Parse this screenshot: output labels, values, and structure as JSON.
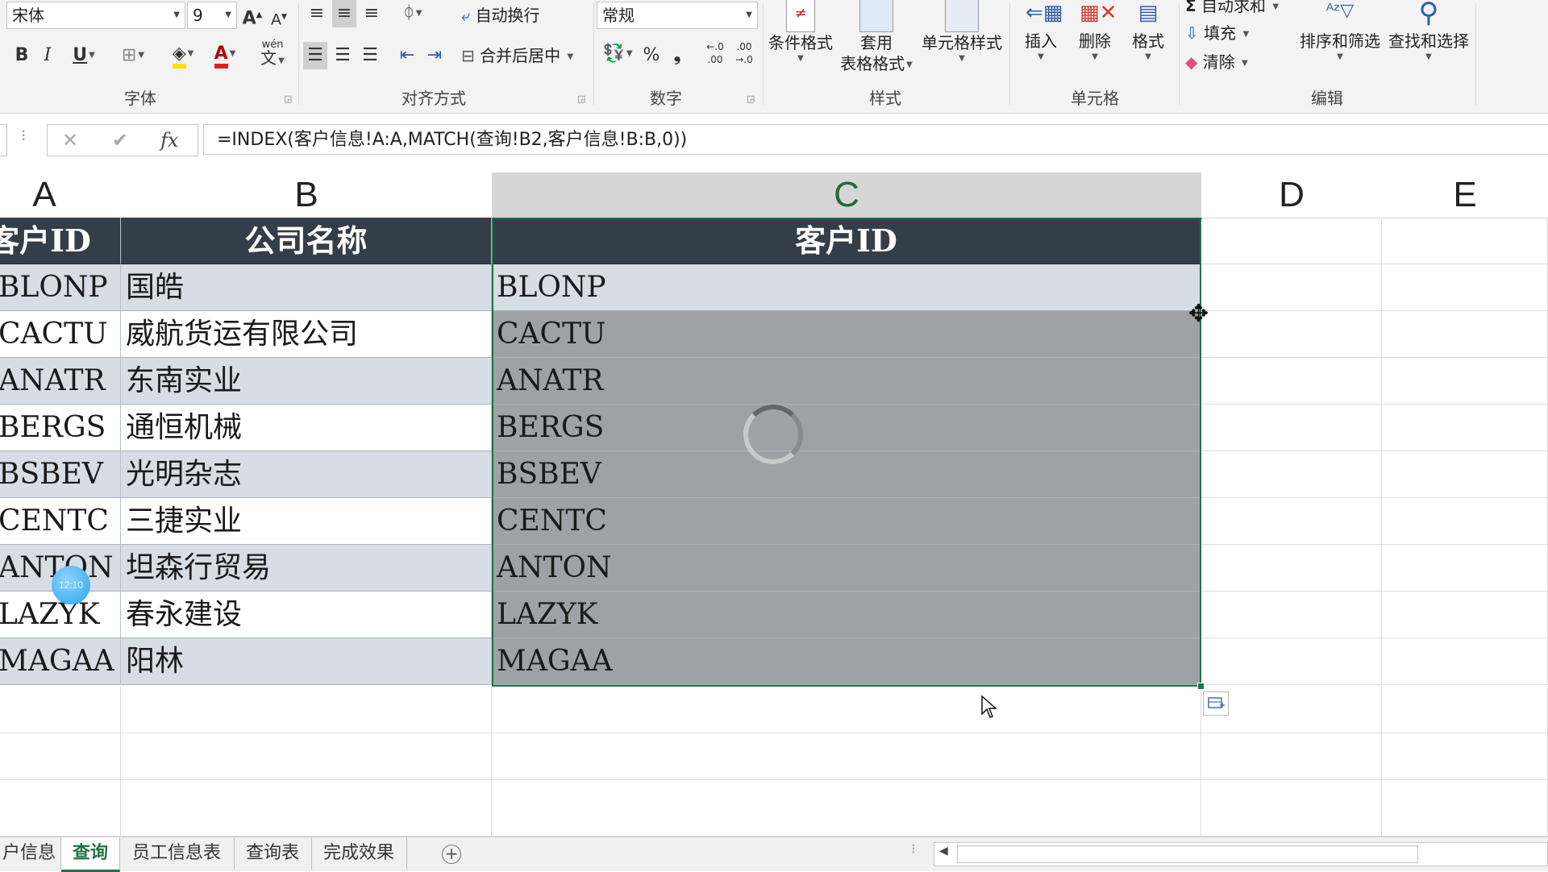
{
  "ribbon": {
    "font_name": "宋体",
    "font_size": "9",
    "wrap_text": "自动换行",
    "merge_center": "合并后居中",
    "number_format": "常规",
    "percent": "%",
    "comma": "❟",
    "bold": "B",
    "italic": "I",
    "underline": "U",
    "phonetic": "wén",
    "phonetic_char": "文",
    "conditional_format": "条件格式",
    "table_format_1": "套用",
    "table_format_2": "表格格式",
    "cell_styles": "单元格样式",
    "insert": "插入",
    "delete": "删除",
    "format": "格式",
    "autosum": "自动求和",
    "fill": "填充",
    "clear": "清除",
    "sort_filter": "排序和筛选",
    "find_select": "查找和选择",
    "groups": {
      "font": "字体",
      "alignment": "对齐方式",
      "number": "数字",
      "styles": "样式",
      "cells": "单元格",
      "editing": "编辑"
    }
  },
  "formula_bar": {
    "formula": "=INDEX(客户信息!A:A,MATCH(查询!B2,客户信息!B:B,0))"
  },
  "columns": [
    "A",
    "B",
    "C",
    "D",
    "E"
  ],
  "table": {
    "headers": [
      "客户ID",
      "公司名称",
      "客户ID"
    ],
    "rows": [
      [
        "BLONP",
        "国皓",
        "BLONP"
      ],
      [
        "CACTU",
        "威航货运有限公司",
        "CACTU"
      ],
      [
        "ANATR",
        "东南实业",
        "ANATR"
      ],
      [
        "BERGS",
        "通恒机械",
        "BERGS"
      ],
      [
        "BSBEV",
        "光明杂志",
        "BSBEV"
      ],
      [
        "CENTC",
        "三捷实业",
        "CENTC"
      ],
      [
        "ANTON",
        "坦森行贸易",
        "ANTON"
      ],
      [
        "LAZYK",
        "春永建设",
        "LAZYK"
      ],
      [
        "MAGAA",
        "阳林",
        "MAGAA"
      ]
    ]
  },
  "overlay": {
    "timer": "12:10"
  },
  "sheet_tabs": [
    {
      "label": "户信息",
      "active": false
    },
    {
      "label": "查询",
      "active": true
    },
    {
      "label": "员工信息表",
      "active": false
    },
    {
      "label": "查询表",
      "active": false
    },
    {
      "label": "完成效果",
      "active": false
    }
  ],
  "colors": {
    "accent": "#217346",
    "table_header_bg": "#343e48",
    "band_bg": "#d6dde5",
    "selection_bg": "#9ea2a6"
  }
}
